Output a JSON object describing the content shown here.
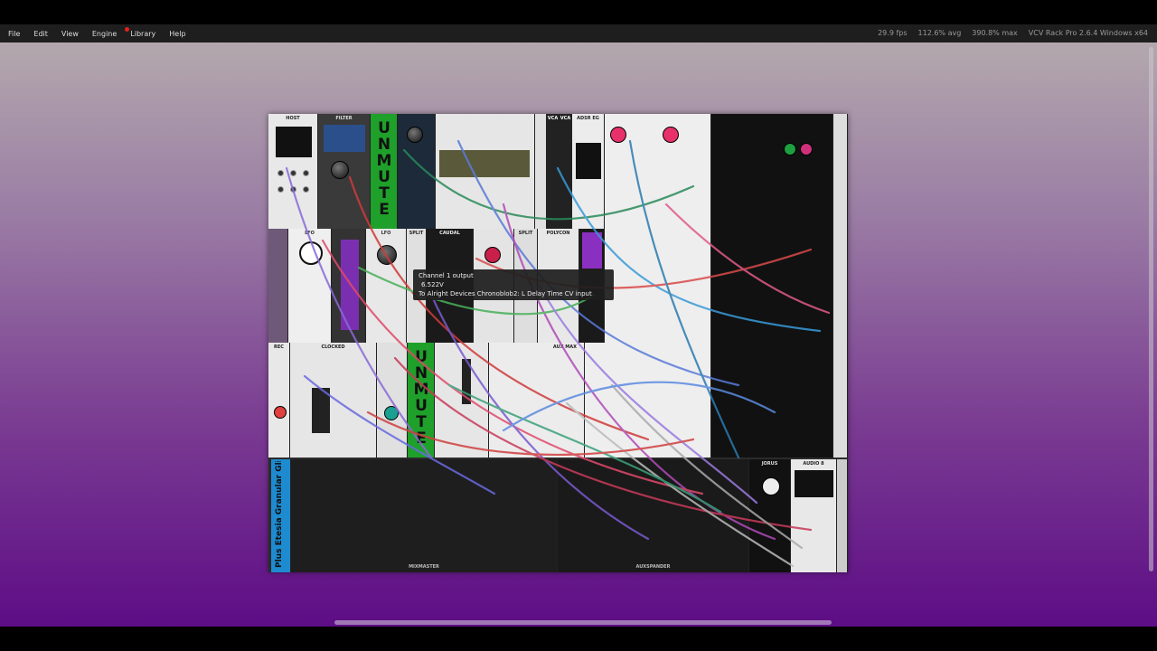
{
  "menu": {
    "items": [
      {
        "label": "File"
      },
      {
        "label": "Edit"
      },
      {
        "label": "View"
      },
      {
        "label": "Engine"
      },
      {
        "label": "Library"
      },
      {
        "label": "Help"
      }
    ],
    "library_notification": true
  },
  "status": {
    "fps": "29.9 fps",
    "avg": "112.6% avg",
    "max": "390.8% max",
    "app": "VCV Rack Pro 2.6.4 Windows x64"
  },
  "modules": {
    "host": "HOST",
    "filter": "FILTER",
    "unmute_top": "UNMUTE",
    "vca1": "VCA",
    "vca2": "VCA",
    "adsr": "ADSR EG",
    "lfo1": "LFO",
    "lfo2": "LFO",
    "split1": "SPLIT",
    "split2": "SPLIT",
    "caudal": "CAUDAL",
    "polycon": "POLYCON",
    "rec": "REC",
    "clocked": "CLOCKED",
    "unmute_bottom": "UNMUTE",
    "aux": "AUX MAX",
    "granular": "Plus Etesia Granular Glitc",
    "mixmaster": "MIXMASTER",
    "auxspander": "AUXSPANDER",
    "jorus": "JORUS",
    "audio8": "AUDIO 8"
  },
  "tooltip": {
    "title": "Channel 1 output",
    "value": "6.522V",
    "connection": "To Alright Devices Chronoblob2: L Delay Time CV input"
  },
  "colors": {
    "menubar": "#1e1e1e",
    "background_top": "#b3a8ad",
    "background_bottom": "#5e0d86",
    "unmute_green": "#1fa02a",
    "granular_blue": "#1e8bd0"
  }
}
